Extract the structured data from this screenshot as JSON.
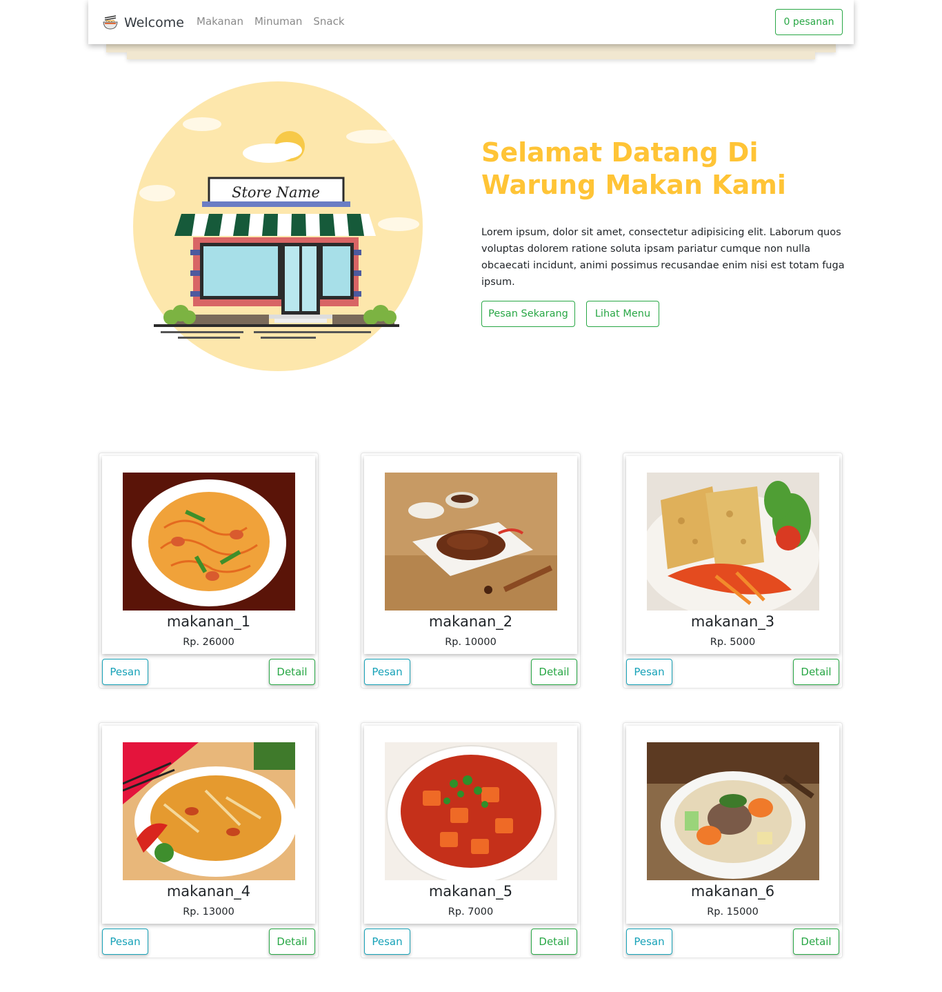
{
  "navbar": {
    "brand": "Welcome",
    "brand_icon": "noodle-bowl-icon",
    "links": [
      "Makanan",
      "Minuman",
      "Snack"
    ],
    "order_button": "0 pesanan"
  },
  "hero": {
    "illustration_sign": "Store Name",
    "title": "Selamat Datang Di Warung Makan Kami",
    "description": "Lorem ipsum, dolor sit amet, consectetur adipisicing elit. Laborum quos voluptas dolorem ratione soluta ipsam pariatur cumque non nulla obcaecati incidunt, animi possimus recusandae enim nisi est totam fuga ipsum.",
    "btn_order": "Pesan Sekarang",
    "btn_menu": "Lihat Menu"
  },
  "menu": {
    "items": [
      {
        "name": "makanan_1",
        "price": "Rp. 26000"
      },
      {
        "name": "makanan_2",
        "price": "Rp. 10000"
      },
      {
        "name": "makanan_3",
        "price": "Rp. 5000"
      },
      {
        "name": "makanan_4",
        "price": "Rp. 13000"
      },
      {
        "name": "makanan_5",
        "price": "Rp. 7000"
      },
      {
        "name": "makanan_6",
        "price": "Rp. 15000"
      }
    ],
    "btn_order_label": "Pesan",
    "btn_detail_label": "Detail"
  },
  "colors": {
    "accent": "#ffc436",
    "success": "#28a745",
    "info": "#17a2b8"
  }
}
